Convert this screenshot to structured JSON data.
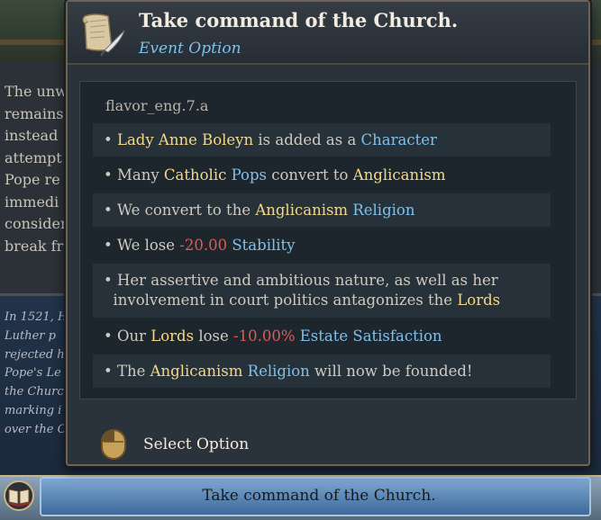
{
  "background": {
    "paragraph_lines": [
      "The unw",
      "remains",
      "instead",
      "attempt",
      "Pope re",
      "immedi",
      "consider",
      "break fr"
    ],
    "italic_lines": [
      "In 1521, H",
      "Luther p",
      "rejected h",
      "Pope's Le",
      "the Churc",
      "marking i",
      "over the C"
    ],
    "bottom_button_label": "Take command of the Church."
  },
  "tooltip": {
    "title": "Take command of the Church.",
    "subtitle": "Event Option",
    "flavor_key": "flavor_eng.7.a",
    "effects": [
      [
        {
          "t": "• ",
          "c": ""
        },
        {
          "t": "Lady Anne Boleyn",
          "c": "gold"
        },
        {
          "t": " is added as a ",
          "c": ""
        },
        {
          "t": "Character",
          "c": "blue"
        }
      ],
      [
        {
          "t": "• Many ",
          "c": ""
        },
        {
          "t": "Catholic",
          "c": "gold"
        },
        {
          "t": " ",
          "c": ""
        },
        {
          "t": "Pops",
          "c": "blue"
        },
        {
          "t": " convert to ",
          "c": ""
        },
        {
          "t": "Anglicanism",
          "c": "gold"
        }
      ],
      [
        {
          "t": "• We convert to the ",
          "c": ""
        },
        {
          "t": "Anglicanism",
          "c": "gold"
        },
        {
          "t": " ",
          "c": ""
        },
        {
          "t": "Religion",
          "c": "blue"
        }
      ],
      [
        {
          "t": "• We lose ",
          "c": ""
        },
        {
          "t": "-20.00",
          "c": "red"
        },
        {
          "t": " ",
          "c": ""
        },
        {
          "t": "Stability",
          "c": "blue"
        }
      ],
      [
        {
          "t": "• Her assertive and ambitious nature, as well as her",
          "c": ""
        },
        {
          "br": true
        },
        {
          "t": "  involvement in court politics antagonizes the ",
          "c": ""
        },
        {
          "t": "Lords",
          "c": "gold"
        }
      ],
      [
        {
          "t": "• Our ",
          "c": ""
        },
        {
          "t": "Lords",
          "c": "gold"
        },
        {
          "t": " lose ",
          "c": ""
        },
        {
          "t": "-10.00%",
          "c": "red"
        },
        {
          "t": " ",
          "c": ""
        },
        {
          "t": "Estate Satisfaction",
          "c": "blue"
        }
      ],
      [
        {
          "t": "• The ",
          "c": ""
        },
        {
          "t": "Anglicanism",
          "c": "gold"
        },
        {
          "t": " ",
          "c": ""
        },
        {
          "t": "Religion",
          "c": "blue"
        },
        {
          "t": " will now be founded!",
          "c": ""
        }
      ]
    ],
    "select_label": "Select Option"
  },
  "colors": {
    "gold": "#f3d889",
    "blue": "#7fc0ea",
    "red": "#e05a55",
    "text": "#cfcac0"
  },
  "icons": {
    "header": "scroll-quill-icon",
    "select": "mouse-left-click-icon",
    "bottom": "book-icon"
  }
}
